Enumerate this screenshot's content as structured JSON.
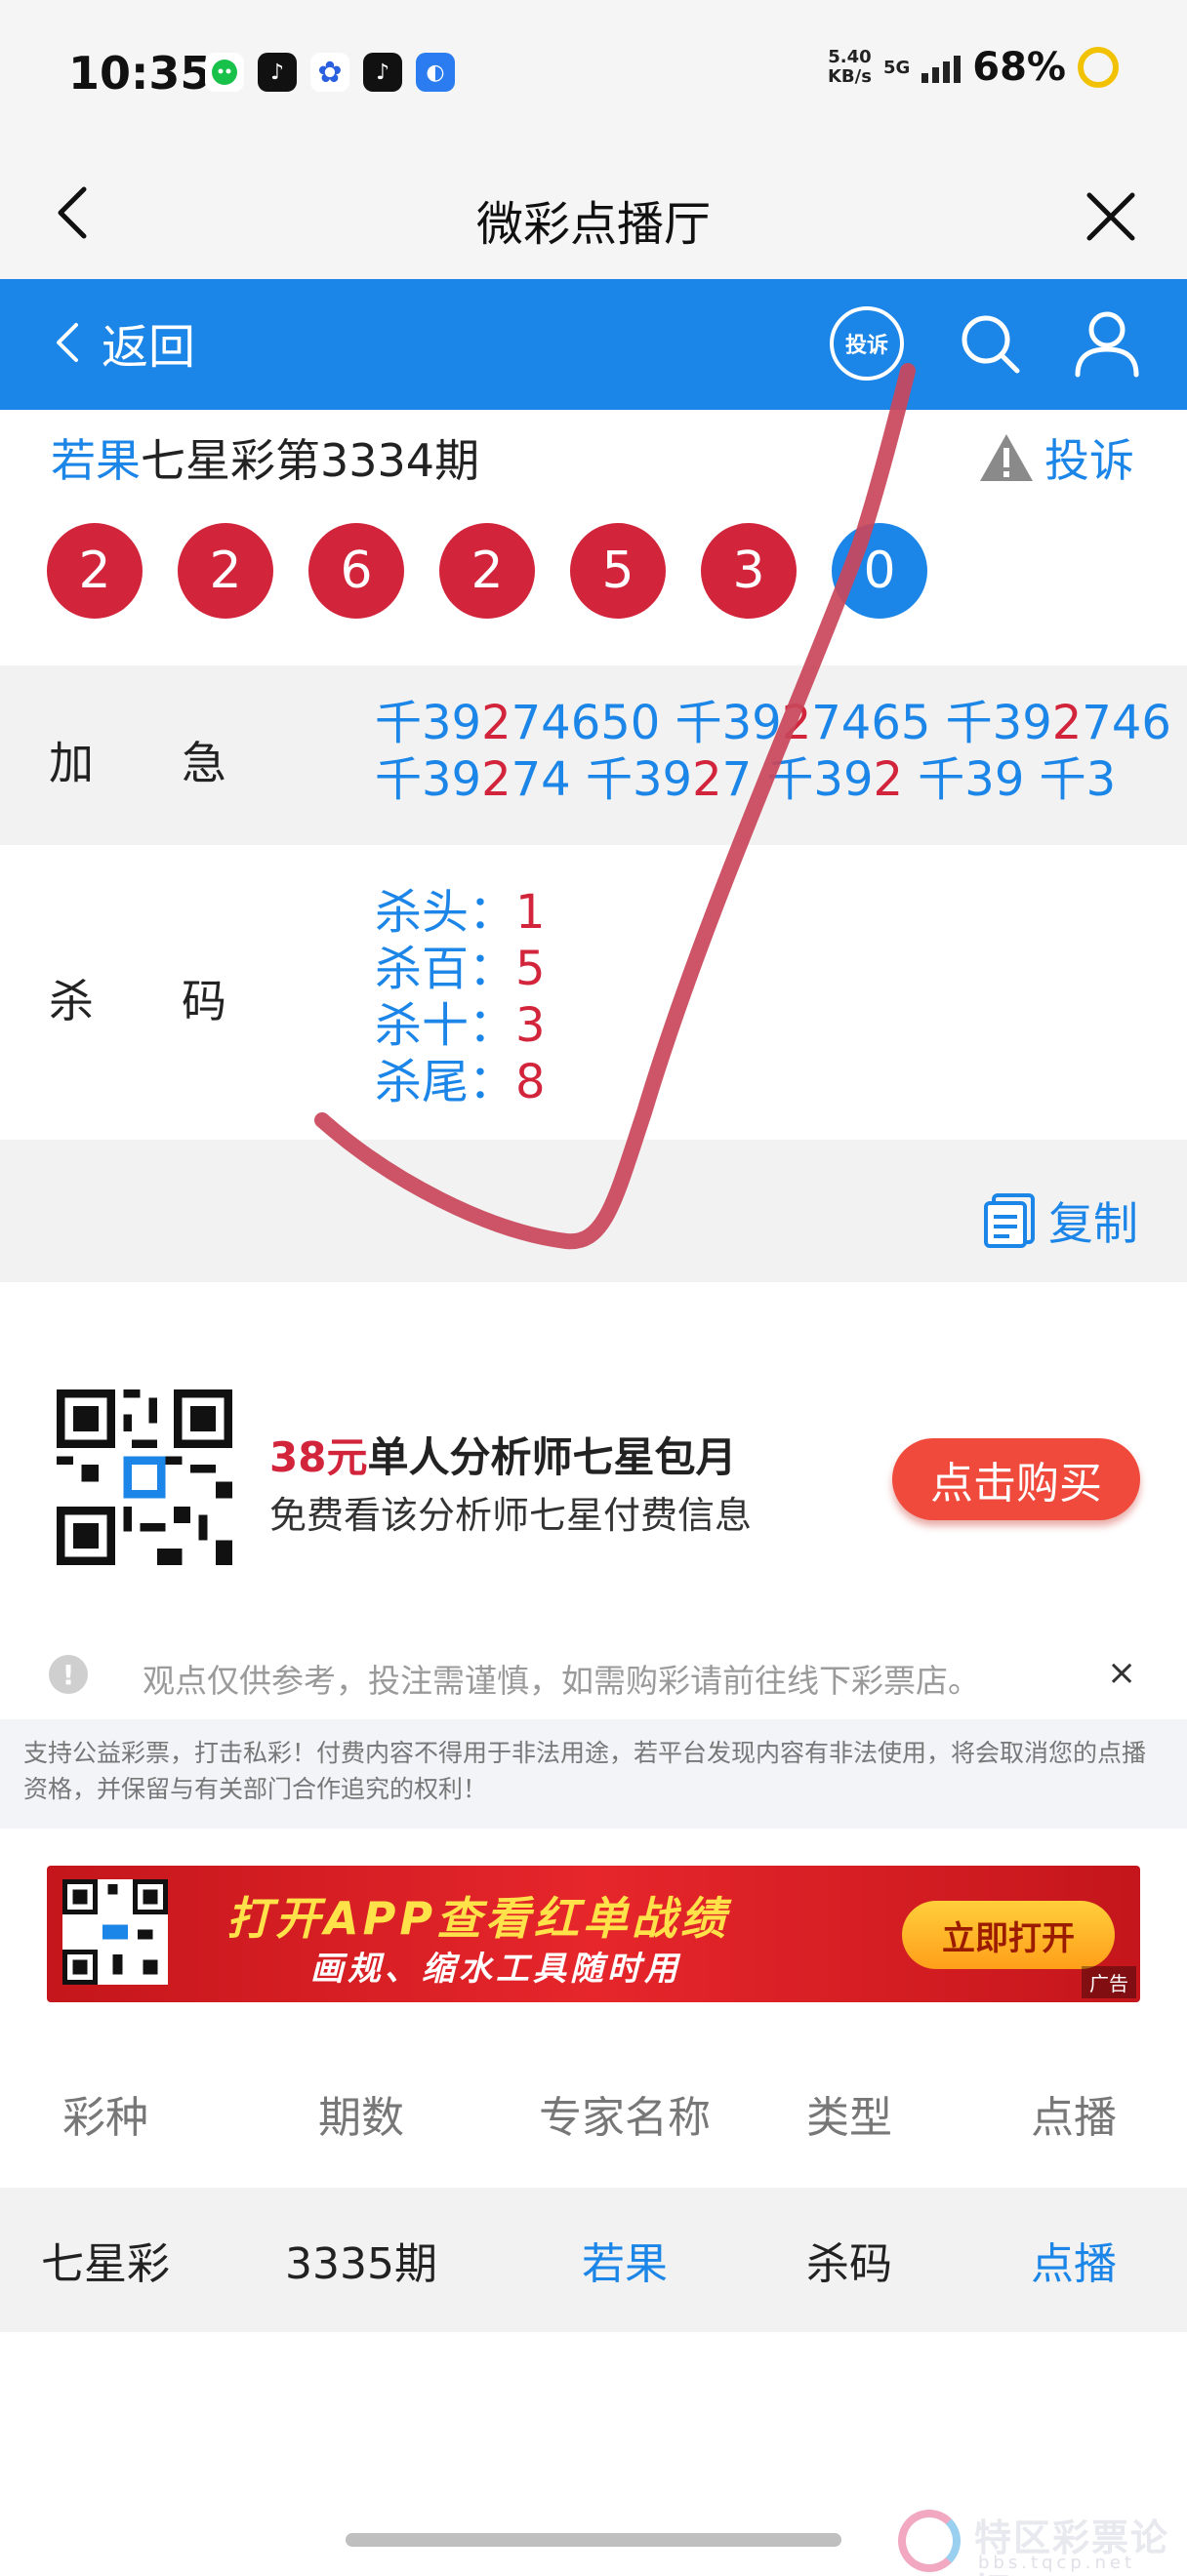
{
  "status_bar": {
    "time": "10:35",
    "net_speed_value": "5.40",
    "net_speed_unit": "KB/s",
    "network": "5G",
    "battery": "68%"
  },
  "title_bar": {
    "title": "微彩点播厅"
  },
  "nav": {
    "back_label": "返回",
    "report_label": "投诉"
  },
  "issue": {
    "expert": "若果",
    "title_rest": "七星彩第3334期",
    "complain_label": "投诉",
    "balls": [
      "2",
      "2",
      "6",
      "2",
      "5",
      "3",
      "0"
    ]
  },
  "jiaji": {
    "label": "加急",
    "line1": [
      [
        "千39",
        "2",
        "74650"
      ],
      [
        " 千39",
        "2",
        "7465"
      ],
      [
        " 千39",
        "2",
        "746"
      ]
    ],
    "line2": [
      [
        "千39",
        "2",
        "74"
      ],
      [
        " 千39",
        "2",
        "7"
      ],
      [
        " 千39",
        "2",
        ""
      ],
      [
        " 千39",
        "",
        ""
      ],
      [
        " 千3",
        "",
        ""
      ]
    ]
  },
  "shama": {
    "label": "杀码",
    "items": [
      {
        "key": "杀头：",
        "value": "1"
      },
      {
        "key": "杀百：",
        "value": "5"
      },
      {
        "key": "杀十：",
        "value": "3"
      },
      {
        "key": "杀尾：",
        "value": "8"
      }
    ]
  },
  "copy_label": "复制",
  "promo": {
    "price": "38元",
    "title": "单人分析师七星包月",
    "subtitle": "免费看该分析师七星付费信息",
    "buy_label": "点击购买"
  },
  "notice": {
    "text": "观点仅供参考，投注需谨慎，如需购彩请前往线下彩票店。",
    "close": "×"
  },
  "disclaimer": "支持公益彩票，打击私彩！付费内容不得用于非法用途，若平台发现内容有非法使用，将会取消您的点播资格，并保留与有关部门合作追究的权利！",
  "banner": {
    "line1": "打开APP查看红单战绩",
    "line2": "画规、缩水工具随时用",
    "button": "立即打开",
    "ad_tag": "广告"
  },
  "table": {
    "headers": [
      "彩种",
      "期数",
      "专家名称",
      "类型",
      "点播"
    ],
    "rows": [
      [
        "七星彩",
        "3335期",
        "若果",
        "杀码",
        "点播"
      ]
    ]
  },
  "watermark": {
    "text": "特区彩票论坛",
    "url": "bbs.tqcp.net"
  },
  "colors": {
    "accent_blue": "#1c86e8",
    "ball_red": "#d2253b",
    "buy_red": "#f04a3d",
    "check_stroke": "#c9465a"
  }
}
